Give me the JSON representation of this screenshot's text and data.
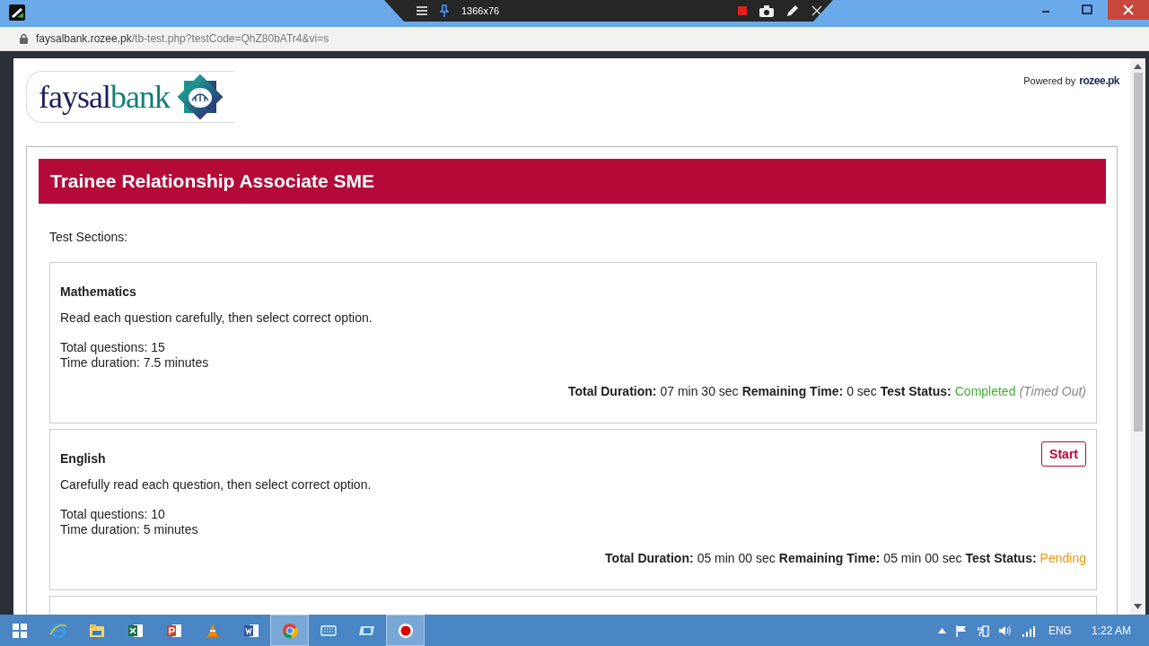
{
  "recorder_toolbar": {
    "resolution": "1366x76"
  },
  "address_bar": {
    "domain": "faysalbank.rozee.pk",
    "path": "/tb-test.php?testCode=QhZ80bATr4&vi=s"
  },
  "header": {
    "logo": {
      "part_1": "faysal",
      "part_2": "bank"
    },
    "powered_by": "Powered by",
    "powered_logo": "rozee.pk"
  },
  "test": {
    "title": "Trainee Relationship Associate SME",
    "sections_label": "Test Sections:",
    "sections": [
      {
        "kind": "full",
        "name": "Mathematics",
        "description": "Read each question carefully, then select correct option.",
        "total_questions": "Total questions: 15",
        "time_duration": "Time duration: 7.5 minutes",
        "total_duration_label": "Total Duration:",
        "total_duration": "07 min 30 sec",
        "remaining_label": "Remaining Time:",
        "remaining": "0 sec",
        "status_label": "Test Status:",
        "status": "Completed",
        "color": "#40b030",
        "status_note": "(Timed Out)"
      },
      {
        "kind": "full",
        "name": "English",
        "description": "Carefully read each question, then select correct option.",
        "start_button": "Start",
        "total_questions": "Total questions: 10",
        "time_duration": "Time duration: 5 minutes",
        "total_duration_label": "Total Duration:",
        "total_duration": "05 min 00 sec",
        "remaining_label": "Remaining Time:",
        "remaining": "05 min 00 sec",
        "status_label": "Test Status:",
        "status": "Pending",
        "color": "#e8980f"
      },
      {
        "kind": "partial"
      }
    ]
  },
  "taskbar": {
    "language": "ENG",
    "clock": "1:22 AM"
  }
}
